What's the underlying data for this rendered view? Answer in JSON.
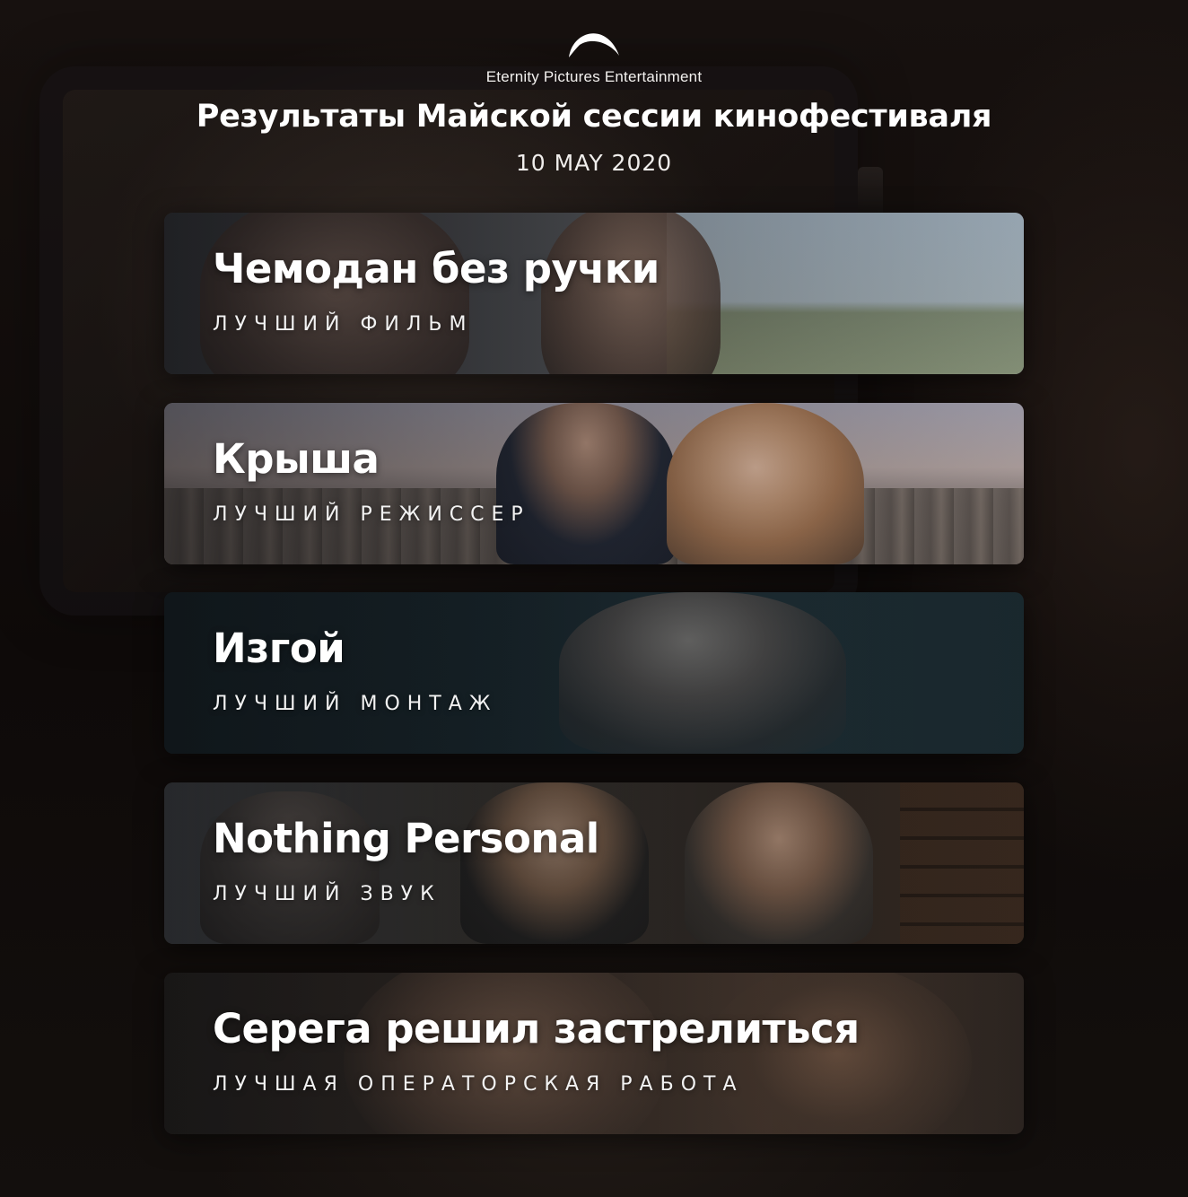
{
  "brand": {
    "logo_icon": "half-moon-arc-logo",
    "name": "Eternity Pictures Entertainment"
  },
  "header": {
    "title": "Результаты Майской сессии кинофестиваля",
    "date": "10 MAY 2020"
  },
  "awards": [
    {
      "film": "Чемодан без ручки",
      "category": "ЛУЧШИЙ ФИЛЬМ"
    },
    {
      "film": "Крыша",
      "category": "ЛУЧШИЙ РЕЖИССЕР"
    },
    {
      "film": "Изгой",
      "category": "ЛУЧШИЙ МОНТАЖ"
    },
    {
      "film": "Nothing Personal",
      "category": "ЛУЧШИЙ ЗВУК"
    },
    {
      "film": "Серега решил застрелиться",
      "category": "ЛУЧШАЯ ОПЕРАТОРСКАЯ РАБОТА"
    }
  ]
}
